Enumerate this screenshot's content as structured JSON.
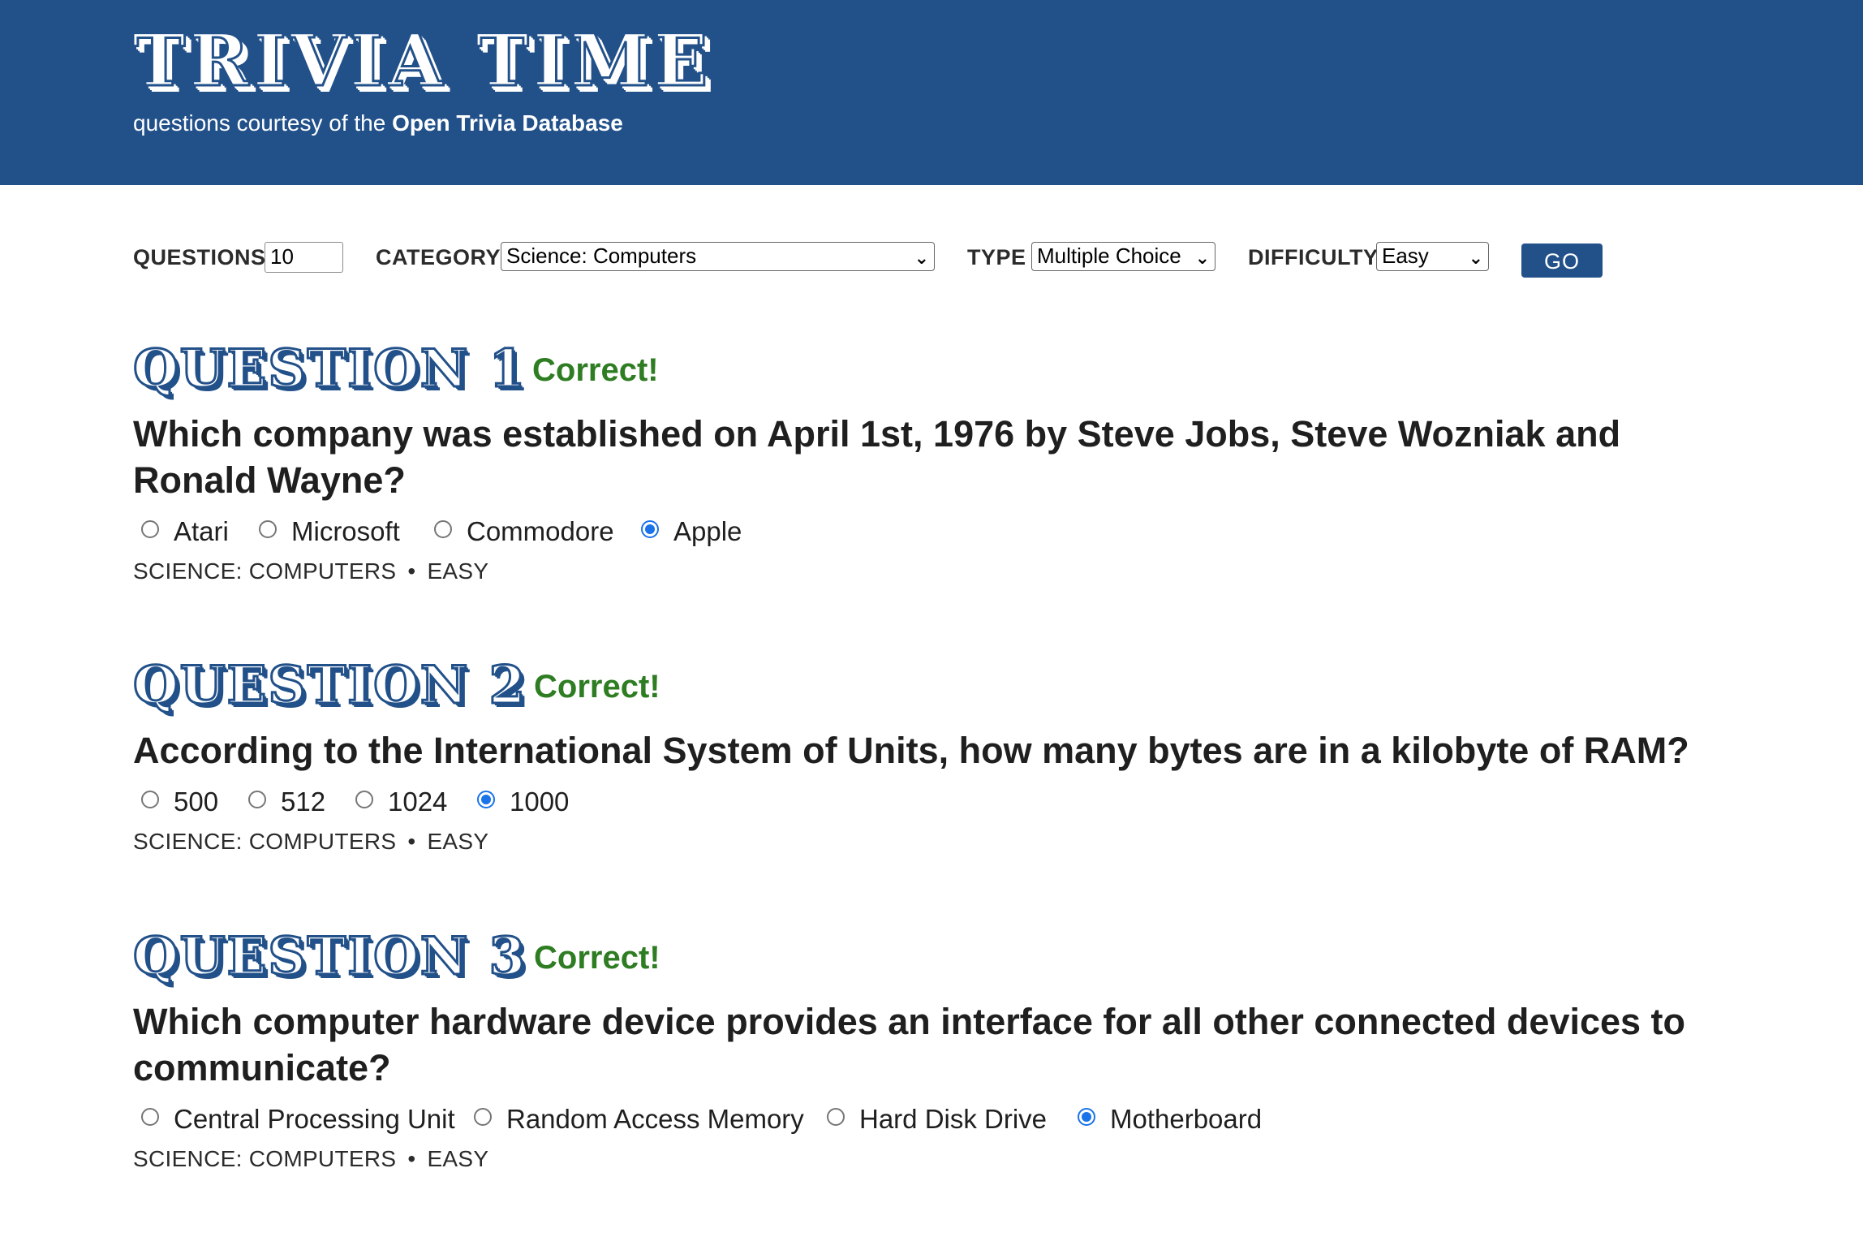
{
  "header": {
    "logo": "TRIVIA TIME",
    "tagline_prefix": "questions courtesy of the ",
    "tagline_link": "Open Trivia Database"
  },
  "controls": {
    "questions_label": "QUESTIONS",
    "questions_value": "10",
    "category_label": "CATEGORY",
    "category_value": "Science: Computers",
    "type_label": "TYPE",
    "type_value": "Multiple Choice",
    "difficulty_label": "DIFFICULTY",
    "difficulty_value": "Easy",
    "go_label": "GO"
  },
  "questions": [
    {
      "title": "QUESTION 1",
      "result": "Correct!",
      "text": "Which company was established on April 1st, 1976 by Steve Jobs, Steve Wozniak and Ronald Wayne?",
      "answers": [
        "Atari",
        "Microsoft",
        "Commodore",
        "Apple"
      ],
      "selected": "Apple",
      "category": "SCIENCE: COMPUTERS",
      "difficulty": "EASY"
    },
    {
      "title": "QUESTION 2",
      "result": "Correct!",
      "text": "According to the International System of Units, how many bytes are in a kilobyte of RAM?",
      "answers": [
        "500",
        "512",
        "1024",
        "1000"
      ],
      "selected": "1000",
      "category": "SCIENCE: COMPUTERS",
      "difficulty": "EASY"
    },
    {
      "title": "QUESTION 3",
      "result": "Correct!",
      "text": "Which computer hardware device provides an interface for all other connected devices to communicate?",
      "answers": [
        "Central Processing Unit",
        "Random Access Memory",
        "Hard Disk Drive",
        "Motherboard"
      ],
      "selected": "Motherboard",
      "category": "SCIENCE: COMPUTERS",
      "difficulty": "EASY"
    }
  ],
  "separator": "•",
  "icons": {
    "select_arrow": "chevron-down-icon",
    "radio": "radio-icon"
  },
  "colors": {
    "header": "#22518a",
    "correct": "#2e7d22",
    "radio_selected": "#1a73e8"
  }
}
